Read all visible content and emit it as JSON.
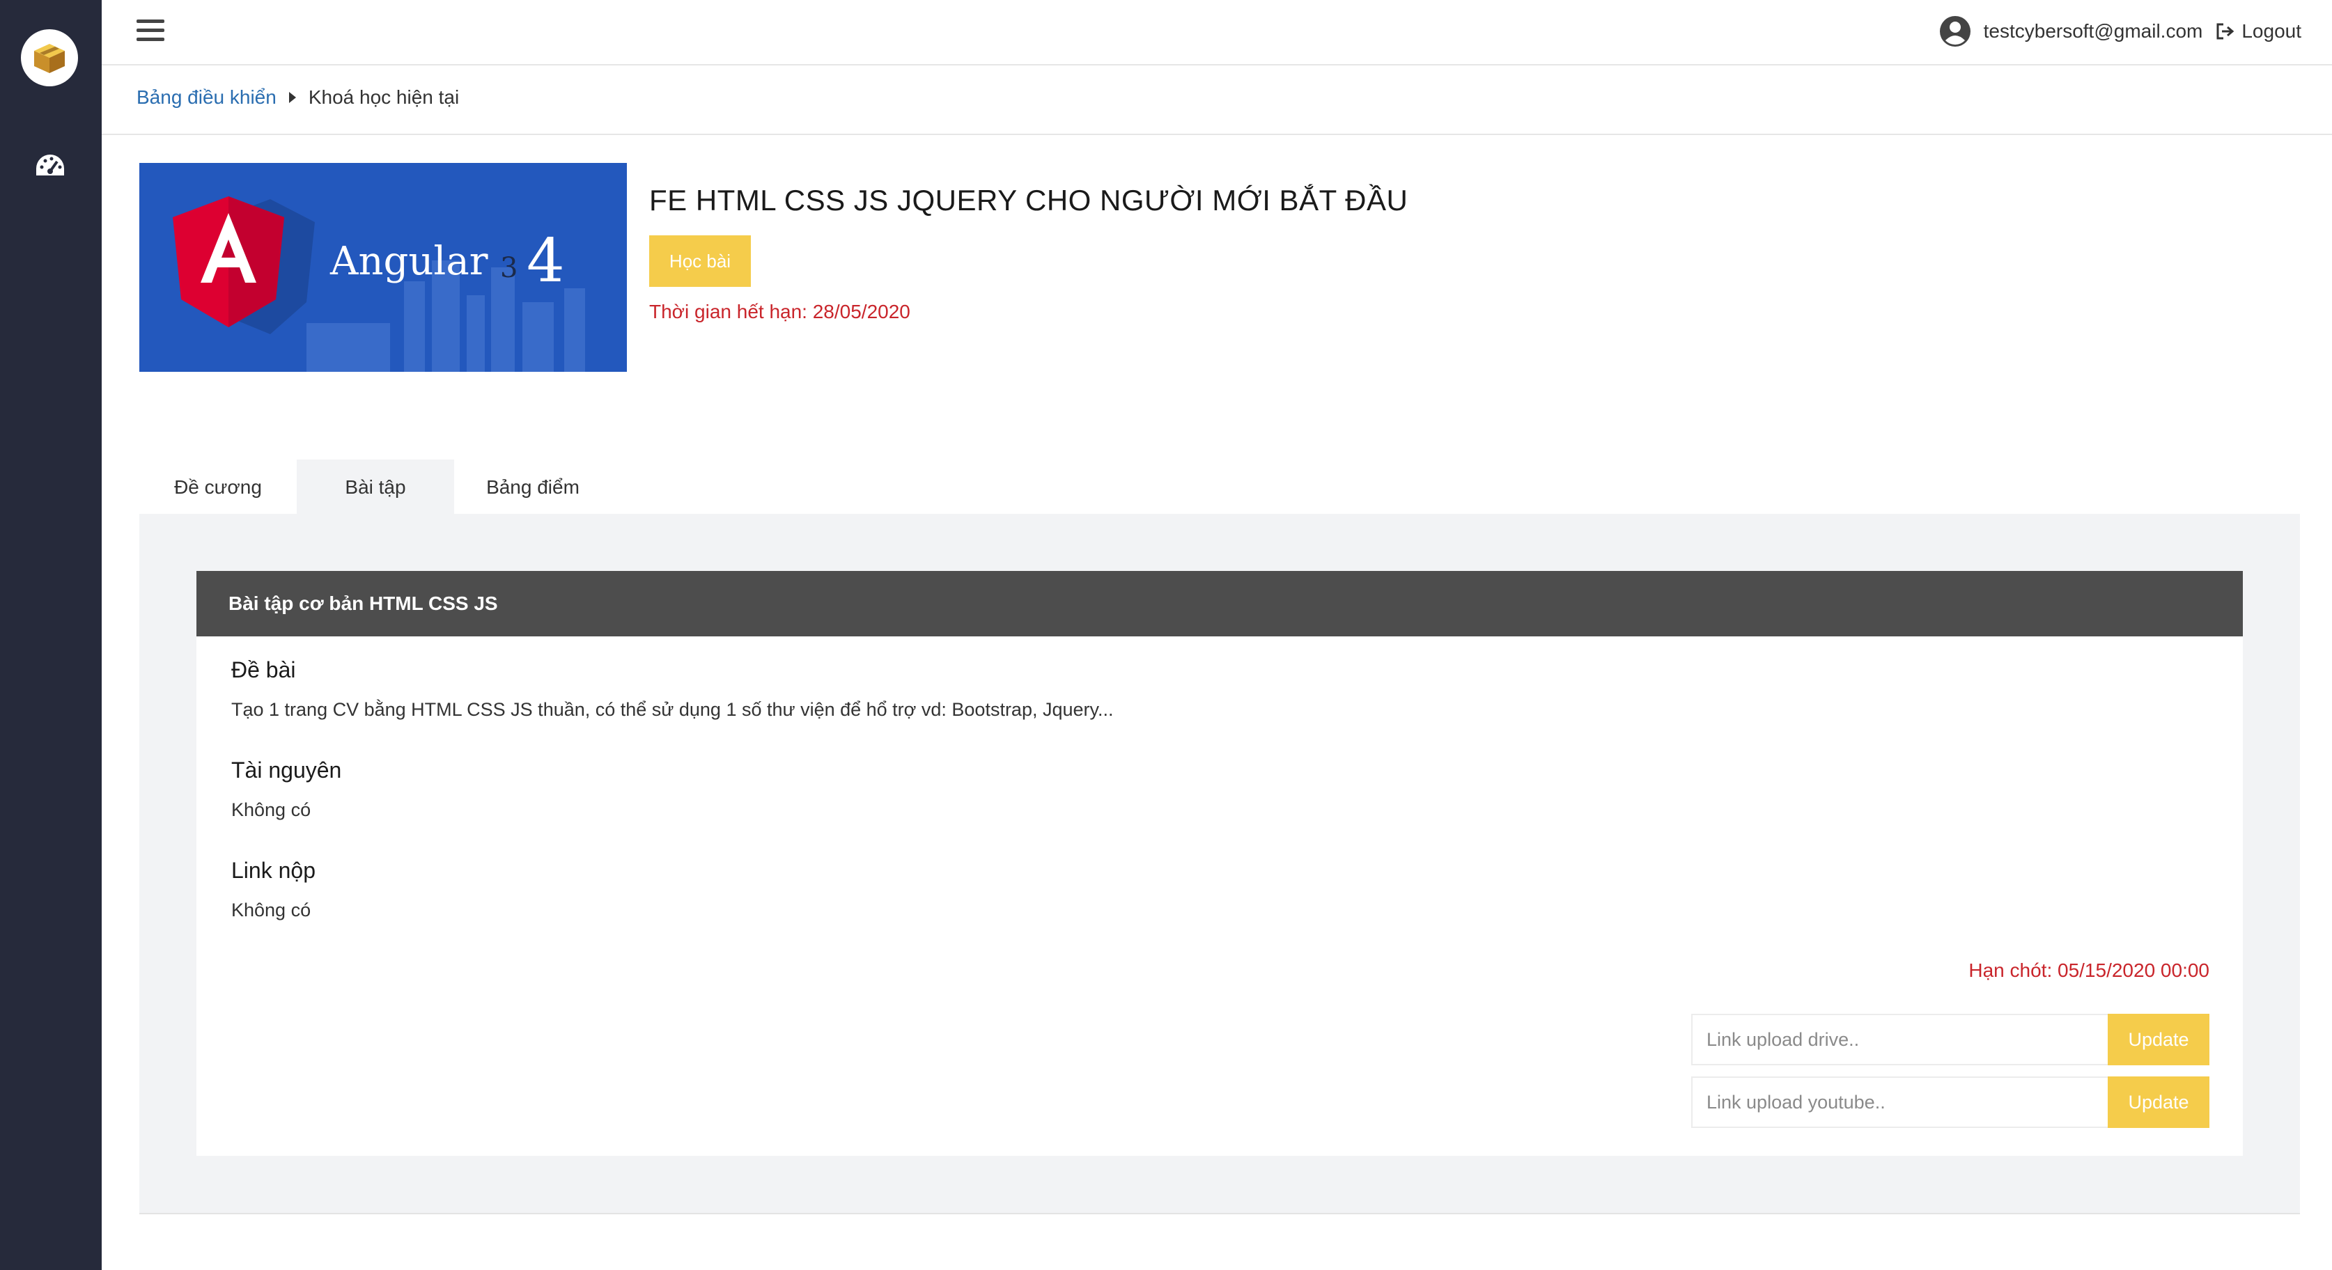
{
  "user": {
    "email": "testcybersoft@gmail.com",
    "logout_label": "Logout"
  },
  "breadcrumb": {
    "home": "Bảng điều khiển",
    "current": "Khoá học hiện tại"
  },
  "course": {
    "image_text": "Angular",
    "image_version_small": "3",
    "image_version_big": "4",
    "title": "FE HTML CSS JS JQUERY CHO NGƯỜI MỚI BẮT ĐẦU",
    "study_button": "Học bài",
    "expiry": "Thời gian hết hạn: 28/05/2020"
  },
  "tabs": [
    {
      "label": "Đề cương"
    },
    {
      "label": "Bài tập"
    },
    {
      "label": "Bảng điểm"
    }
  ],
  "assignment": {
    "header": "Bài tập cơ bản HTML CSS JS",
    "topic_title": "Đề bài",
    "topic_text": "Tạo 1 trang CV bằng HTML CSS JS thuần, có thể sử dụng 1 số thư viện để hổ trợ vd: Bootstrap, Jquery...",
    "resources_title": "Tài nguyên",
    "resources_text": "Không có",
    "submit_title": "Link nộp",
    "submit_text": "Không có",
    "deadline": "Hạn chót: 05/15/2020 00:00",
    "drive_placeholder": "Link upload drive..",
    "youtube_placeholder": "Link upload youtube..",
    "update_label": "Update"
  },
  "colors": {
    "sidebar": "#262a3b",
    "accent": "#f5cc4b",
    "danger": "#c9252b",
    "link": "#2a6db0"
  }
}
